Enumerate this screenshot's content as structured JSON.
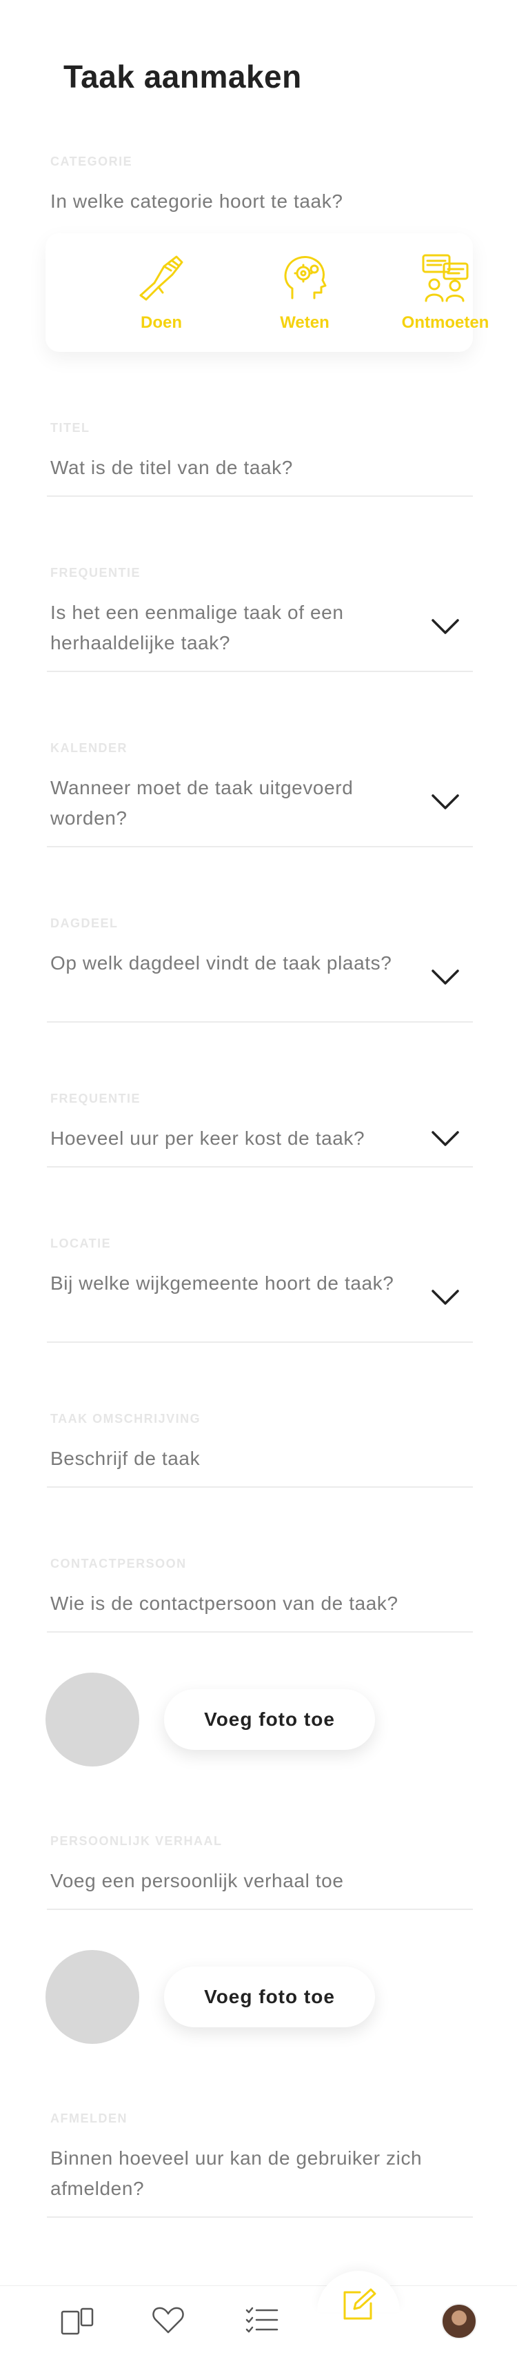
{
  "page": {
    "title": "Taak aanmaken"
  },
  "category": {
    "label": "CATEGORIE",
    "question": "In welke categorie hoort te taak?",
    "options": [
      {
        "label": "Doen",
        "icon": "handshake-icon"
      },
      {
        "label": "Weten",
        "icon": "brain-gears-icon"
      },
      {
        "label": "Ontmoeten",
        "icon": "people-chat-icon"
      }
    ],
    "accent": "#f5d20f"
  },
  "fields": {
    "titel": {
      "label": "TITEL",
      "question": "Wat is de titel van de taak?"
    },
    "frequentie": {
      "label": "FREQUENTIE",
      "question": "Is het een eenmalige taak of een herhaaldelijke taak?"
    },
    "kalender": {
      "label": "KALENDER",
      "question": "Wanneer moet de taak uitgevoerd worden?"
    },
    "dagdeel": {
      "label": "DAGDEEL",
      "question": "Op welk dagdeel vindt de taak plaats?"
    },
    "uren": {
      "label": "FREQUENTIE",
      "question": "Hoeveel uur per keer kost de taak?"
    },
    "locatie": {
      "label": "LOCATIE",
      "question": "Bij welke wijkgemeente hoort de taak?"
    },
    "omschrijving": {
      "label": "TAAK OMSCHRIJVING",
      "question": "Beschrijf de taak"
    },
    "contactpersoon": {
      "label": "CONTACTPERSOON",
      "question": "Wie is de contactpersoon van de taak?",
      "photo_button": "Voeg foto toe"
    },
    "verhaal": {
      "label": "PERSOONLIJK VERHAAL",
      "question": "Voeg een persoonlijk verhaal toe",
      "photo_button": "Voeg foto toe"
    },
    "afmelden": {
      "label": "AFMELDEN",
      "question": "Binnen hoeveel uur kan de gebruiker zich afmelden?"
    }
  },
  "tabbar": {
    "items": [
      "cards-icon",
      "heart-icon",
      "checklist-icon",
      "edit-icon",
      "avatar"
    ],
    "active": "edit-icon"
  }
}
